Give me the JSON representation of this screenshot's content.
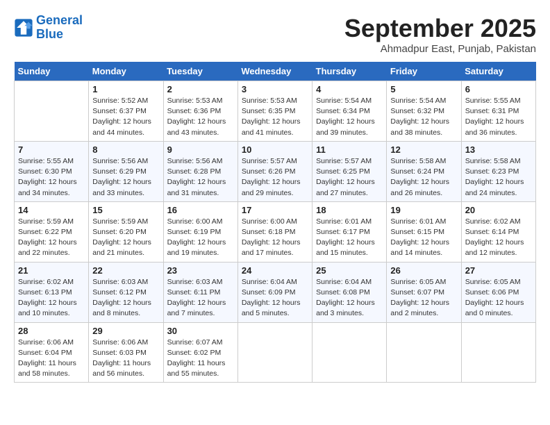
{
  "header": {
    "logo_general": "General",
    "logo_blue": "Blue",
    "month_title": "September 2025",
    "location": "Ahmadpur East, Punjab, Pakistan"
  },
  "days_of_week": [
    "Sunday",
    "Monday",
    "Tuesday",
    "Wednesday",
    "Thursday",
    "Friday",
    "Saturday"
  ],
  "weeks": [
    [
      {
        "day": "",
        "info": ""
      },
      {
        "day": "1",
        "info": "Sunrise: 5:52 AM\nSunset: 6:37 PM\nDaylight: 12 hours\nand 44 minutes."
      },
      {
        "day": "2",
        "info": "Sunrise: 5:53 AM\nSunset: 6:36 PM\nDaylight: 12 hours\nand 43 minutes."
      },
      {
        "day": "3",
        "info": "Sunrise: 5:53 AM\nSunset: 6:35 PM\nDaylight: 12 hours\nand 41 minutes."
      },
      {
        "day": "4",
        "info": "Sunrise: 5:54 AM\nSunset: 6:34 PM\nDaylight: 12 hours\nand 39 minutes."
      },
      {
        "day": "5",
        "info": "Sunrise: 5:54 AM\nSunset: 6:32 PM\nDaylight: 12 hours\nand 38 minutes."
      },
      {
        "day": "6",
        "info": "Sunrise: 5:55 AM\nSunset: 6:31 PM\nDaylight: 12 hours\nand 36 minutes."
      }
    ],
    [
      {
        "day": "7",
        "info": "Sunrise: 5:55 AM\nSunset: 6:30 PM\nDaylight: 12 hours\nand 34 minutes."
      },
      {
        "day": "8",
        "info": "Sunrise: 5:56 AM\nSunset: 6:29 PM\nDaylight: 12 hours\nand 33 minutes."
      },
      {
        "day": "9",
        "info": "Sunrise: 5:56 AM\nSunset: 6:28 PM\nDaylight: 12 hours\nand 31 minutes."
      },
      {
        "day": "10",
        "info": "Sunrise: 5:57 AM\nSunset: 6:26 PM\nDaylight: 12 hours\nand 29 minutes."
      },
      {
        "day": "11",
        "info": "Sunrise: 5:57 AM\nSunset: 6:25 PM\nDaylight: 12 hours\nand 27 minutes."
      },
      {
        "day": "12",
        "info": "Sunrise: 5:58 AM\nSunset: 6:24 PM\nDaylight: 12 hours\nand 26 minutes."
      },
      {
        "day": "13",
        "info": "Sunrise: 5:58 AM\nSunset: 6:23 PM\nDaylight: 12 hours\nand 24 minutes."
      }
    ],
    [
      {
        "day": "14",
        "info": "Sunrise: 5:59 AM\nSunset: 6:22 PM\nDaylight: 12 hours\nand 22 minutes."
      },
      {
        "day": "15",
        "info": "Sunrise: 5:59 AM\nSunset: 6:20 PM\nDaylight: 12 hours\nand 21 minutes."
      },
      {
        "day": "16",
        "info": "Sunrise: 6:00 AM\nSunset: 6:19 PM\nDaylight: 12 hours\nand 19 minutes."
      },
      {
        "day": "17",
        "info": "Sunrise: 6:00 AM\nSunset: 6:18 PM\nDaylight: 12 hours\nand 17 minutes."
      },
      {
        "day": "18",
        "info": "Sunrise: 6:01 AM\nSunset: 6:17 PM\nDaylight: 12 hours\nand 15 minutes."
      },
      {
        "day": "19",
        "info": "Sunrise: 6:01 AM\nSunset: 6:15 PM\nDaylight: 12 hours\nand 14 minutes."
      },
      {
        "day": "20",
        "info": "Sunrise: 6:02 AM\nSunset: 6:14 PM\nDaylight: 12 hours\nand 12 minutes."
      }
    ],
    [
      {
        "day": "21",
        "info": "Sunrise: 6:02 AM\nSunset: 6:13 PM\nDaylight: 12 hours\nand 10 minutes."
      },
      {
        "day": "22",
        "info": "Sunrise: 6:03 AM\nSunset: 6:12 PM\nDaylight: 12 hours\nand 8 minutes."
      },
      {
        "day": "23",
        "info": "Sunrise: 6:03 AM\nSunset: 6:11 PM\nDaylight: 12 hours\nand 7 minutes."
      },
      {
        "day": "24",
        "info": "Sunrise: 6:04 AM\nSunset: 6:09 PM\nDaylight: 12 hours\nand 5 minutes."
      },
      {
        "day": "25",
        "info": "Sunrise: 6:04 AM\nSunset: 6:08 PM\nDaylight: 12 hours\nand 3 minutes."
      },
      {
        "day": "26",
        "info": "Sunrise: 6:05 AM\nSunset: 6:07 PM\nDaylight: 12 hours\nand 2 minutes."
      },
      {
        "day": "27",
        "info": "Sunrise: 6:05 AM\nSunset: 6:06 PM\nDaylight: 12 hours\nand 0 minutes."
      }
    ],
    [
      {
        "day": "28",
        "info": "Sunrise: 6:06 AM\nSunset: 6:04 PM\nDaylight: 11 hours\nand 58 minutes."
      },
      {
        "day": "29",
        "info": "Sunrise: 6:06 AM\nSunset: 6:03 PM\nDaylight: 11 hours\nand 56 minutes."
      },
      {
        "day": "30",
        "info": "Sunrise: 6:07 AM\nSunset: 6:02 PM\nDaylight: 11 hours\nand 55 minutes."
      },
      {
        "day": "",
        "info": ""
      },
      {
        "day": "",
        "info": ""
      },
      {
        "day": "",
        "info": ""
      },
      {
        "day": "",
        "info": ""
      }
    ]
  ]
}
